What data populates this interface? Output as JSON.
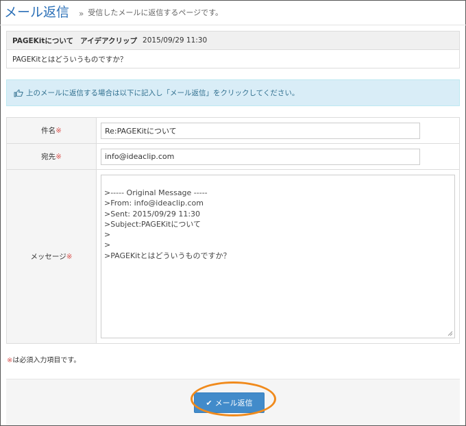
{
  "page": {
    "title": "メール返信",
    "separator": "»",
    "subtitle": "受信したメールに返信するページです。"
  },
  "original_message": {
    "subject": "PAGEKitについて",
    "sender": "アイデアクリップ",
    "date": "2015/09/29 11:30",
    "body": "PAGEKitとはどういうものですか？"
  },
  "info": {
    "text": "上のメールに返信する場合は以下に記入し「メール返信」をクリックしてください。",
    "icon": "hand-pointing-icon"
  },
  "form": {
    "subject_label": "件名",
    "subject_value": "Re:PAGEKitについて",
    "to_label": "宛先",
    "to_value": "info@ideaclip.com",
    "message_label": "メッセージ",
    "message_lines": [
      "",
      ">----- Original Message -----",
      ">From: info@ideaclip.com",
      ">Sent: 2015/09/29 11:30",
      ">Subject:PAGEKitについて",
      ">",
      ">",
      ">PAGEKitとはどういうものですか？"
    ],
    "required_mark": "※"
  },
  "note": {
    "mark": "※",
    "text": "は必須入力項目です。"
  },
  "submit": {
    "label": "メール返信",
    "icon": "check-icon"
  },
  "colors": {
    "title": "#2a6fb7",
    "info_bg": "#d9edf7",
    "info_text": "#31708f",
    "required": "#d9534f",
    "button": "#428bca",
    "highlight_ring": "#f08a1c"
  }
}
